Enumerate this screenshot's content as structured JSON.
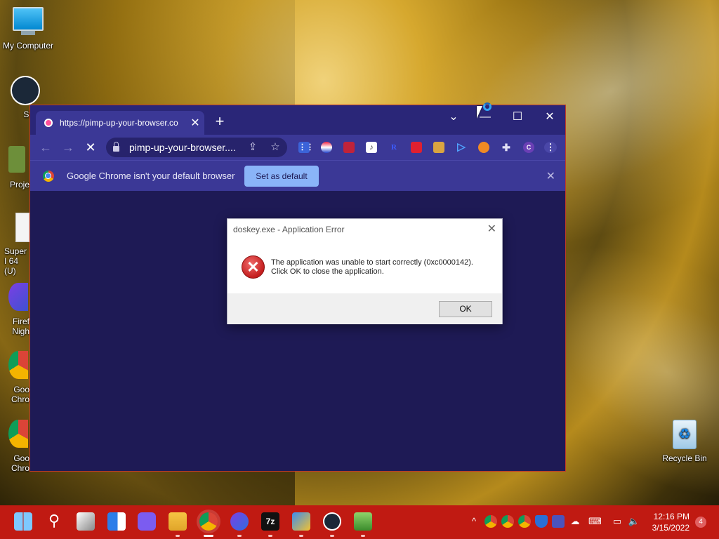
{
  "desktop": {
    "icons": [
      {
        "label": "My Computer"
      },
      {
        "label": "Stea"
      },
      {
        "label": "Proje"
      },
      {
        "label": "Super I 64 (U)"
      },
      {
        "label": "Firef Nigh"
      },
      {
        "label": "Goo Chro"
      },
      {
        "label": "Goo Chro"
      },
      {
        "label": "Recycle Bin"
      }
    ]
  },
  "browser": {
    "tab_title": "https://pimp-up-your-browser.co",
    "new_tab": "+",
    "controls": {
      "dropdown": "⌄",
      "minimize": "—",
      "maximize": "☐",
      "close": "✕"
    },
    "nav": {
      "back": "←",
      "forward": "→",
      "stop": "✕"
    },
    "omnibox_text": "pimp-up-your-browser....",
    "infobar": {
      "message": "Google Chrome isn't your default browser",
      "button": "Set as default",
      "close": "✕"
    }
  },
  "dialog": {
    "title": "doskey.exe - Application Error",
    "close": "✕",
    "line1": "The application was unable to start correctly (0xc0000142).",
    "line2": "Click OK to close the application.",
    "ok": "OK"
  },
  "taskbar": {
    "time": "12:16 PM",
    "date": "3/15/2022",
    "notifications": "4",
    "tray_chevron": "^"
  },
  "colors": {
    "taskbar": "#c01a12",
    "browser_bg": "#1e1a55",
    "toolbar": "#3b3896",
    "accent_button": "#8ab4f8",
    "error_red": "#c41e1e"
  }
}
